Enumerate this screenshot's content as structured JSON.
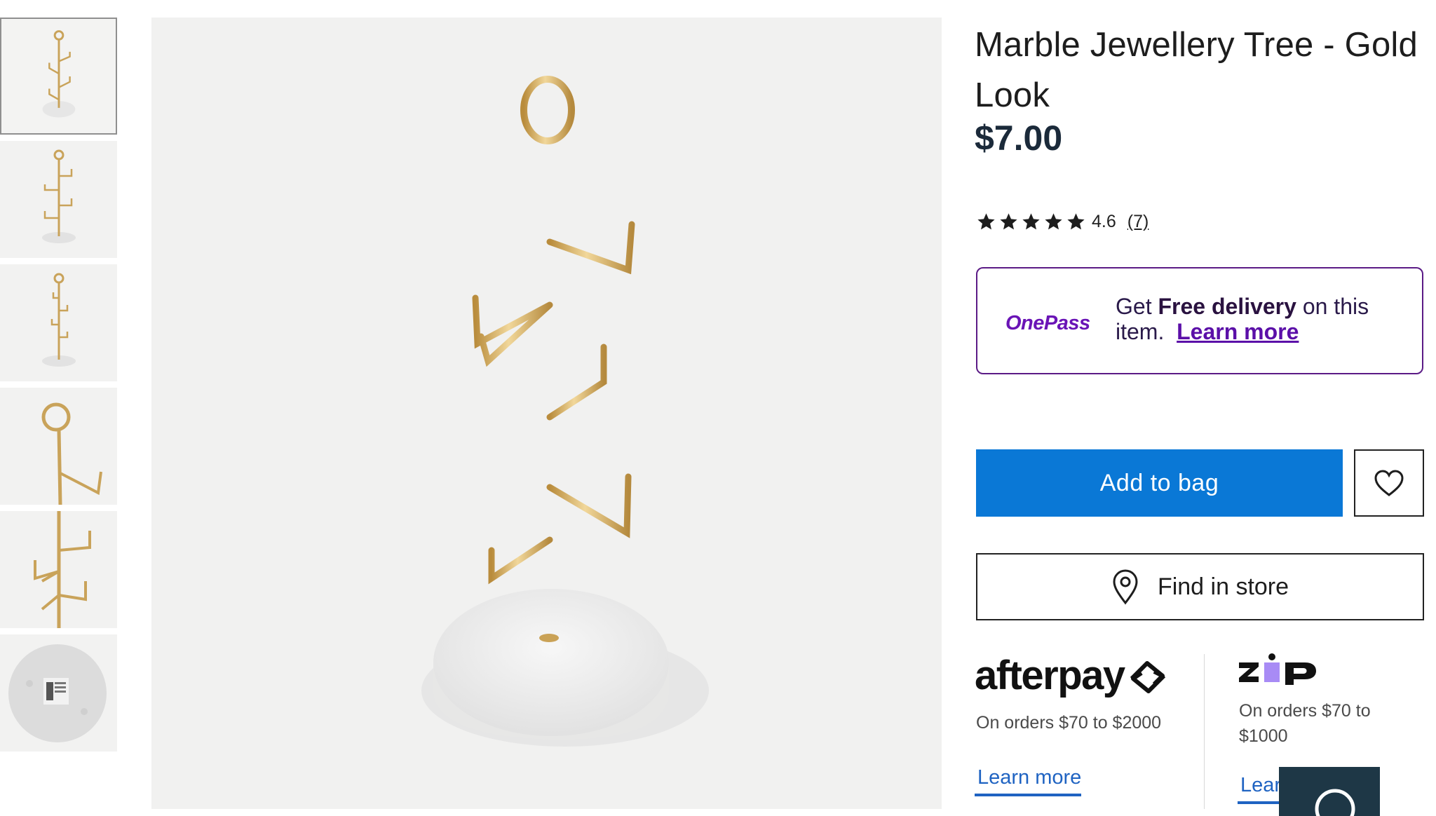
{
  "gallery": {
    "thumbnails": [
      {
        "name": "product-thumb-front"
      },
      {
        "name": "product-thumb-side"
      },
      {
        "name": "product-thumb-back"
      },
      {
        "name": "product-thumb-closeup-top"
      },
      {
        "name": "product-thumb-closeup-hooks"
      },
      {
        "name": "product-thumb-base-underside"
      }
    ],
    "expand_icon": "expand-icon"
  },
  "product": {
    "title": "Marble Jewellery Tree - Gold Look",
    "price": "$7.00",
    "rating": {
      "value": "4.6",
      "count": "(7)",
      "stars": 4.6
    }
  },
  "onepass": {
    "logo": "OnePass",
    "text_prefix": "Get ",
    "text_bold": "Free delivery",
    "text_suffix": " on this item.",
    "learn_more": "Learn more"
  },
  "actions": {
    "add_to_bag": "Add to bag",
    "wishlist_icon": "heart-icon",
    "find_in_store": "Find in store"
  },
  "payments": {
    "afterpay": {
      "logo": "afterpay",
      "note": "On orders $70 to $2000",
      "learn_more": "Learn more"
    },
    "zip": {
      "logo": "zip",
      "note": "On orders $70 to $1000",
      "learn_more": "Learn more"
    }
  },
  "colors": {
    "accent_blue": "#0a78d6",
    "onepass_purple": "#5b1b86",
    "price": "#1b2a3a",
    "link_blue": "#1f63c2"
  }
}
